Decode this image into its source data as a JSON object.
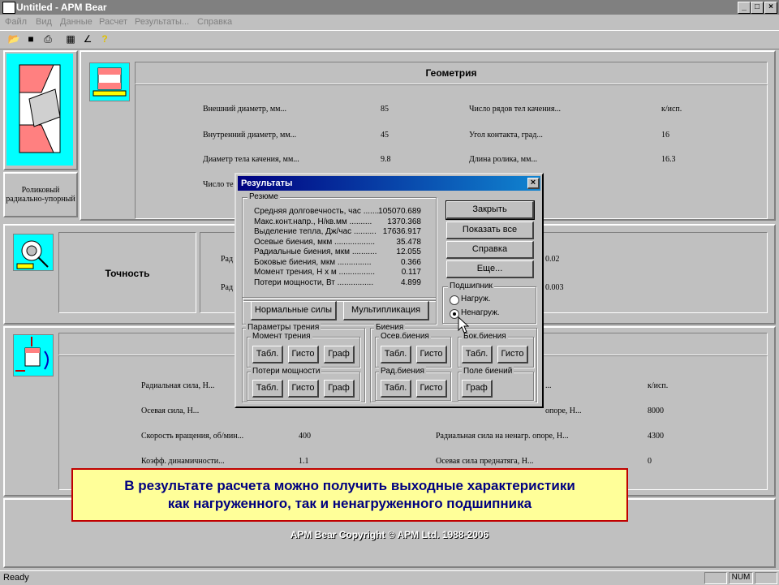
{
  "window": {
    "title": "Untitled - APM Bear"
  },
  "menu": [
    "Файл",
    "Вид",
    "Данные",
    "Расчет",
    "Результаты...",
    "Справка"
  ],
  "toolbar_icons": [
    "open-icon",
    "save-icon",
    "print-icon",
    "table-icon",
    "chart-icon",
    "help-icon"
  ],
  "left_panel": {
    "bearing_label_1": "Роликовый",
    "bearing_label_2": "радиально-упорный"
  },
  "geometry": {
    "title": "Геометрия",
    "rows": [
      {
        "label": "Внешний диаметр, мм...",
        "value": "85",
        "label2": "Число рядов тел качения...",
        "value2": "к/исп."
      },
      {
        "label": "Внутренний диаметр, мм...",
        "value": "45",
        "label2": "Угол контакта, град...",
        "value2": "16"
      },
      {
        "label": "Диаметр тела качения, мм...",
        "value": "9.8",
        "label2": "Длина ролика, мм...",
        "value2": "16.3"
      },
      {
        "label": "Число те",
        "value": "",
        "label2": "",
        "value2": ""
      }
    ]
  },
  "precision": {
    "title": "Точность",
    "row1_label": "Рад",
    "row1_value": "0.02",
    "row2_label": "Рад",
    "row2_value": "0.003"
  },
  "loads": {
    "rows": [
      {
        "label": "Радиальная сила, Н...",
        "value": "",
        "label2": "...",
        "value2": "к/исп."
      },
      {
        "label": "Осевая сила, Н...",
        "value": "",
        "label2": "опоре, Н...",
        "value2": "8000"
      },
      {
        "label": "Скорость вращения, об/мин...",
        "value": "400",
        "label2": "Радиальная сила на ненагр. опоре, Н...",
        "value2": "4300"
      },
      {
        "label": "Коэфф. динамичности...",
        "value": "1.1",
        "label2": "Осевая сила преднатяга, Н...",
        "value2": "0"
      }
    ]
  },
  "dialog": {
    "title": "Результаты",
    "summary_label": "Резюме",
    "summary": [
      {
        "label": "Средняя долговечность, час .......",
        "value": "105070.689"
      },
      {
        "label": "Макс.конт.напр., Н/кв.мм ..........",
        "value": "1370.368"
      },
      {
        "label": "Выделение тепла, Дж/час ..........",
        "value": "17636.917"
      },
      {
        "label": "Осевые биения, мкм ..................",
        "value": "35.478"
      },
      {
        "label": "Радиальные биения, мкм ...........",
        "value": "12.055"
      },
      {
        "label": "Боковые биения, мкм ...............",
        "value": "0.366"
      },
      {
        "label": "Момент трения, Н х м ................",
        "value": "0.117"
      },
      {
        "label": "Потери мощности, Вт ................",
        "value": "4.899"
      }
    ],
    "buttons": {
      "close": "Закрыть",
      "show_all": "Показать все",
      "help": "Справка",
      "more": "Еще..."
    },
    "bearing_group": "Подшипник",
    "radio_loaded": "Нагруж.",
    "radio_unloaded": "Ненагруж.",
    "selected": "Ненагруж.",
    "normal_forces": "Нормальные силы",
    "multiplication": "Мультипликация",
    "friction_group": "Параметры трения",
    "moment_group": "Момент трения",
    "power_group": "Потери мощности",
    "runout_group": "Биения",
    "axial_runout": "Осев.биения",
    "radial_runout": "Рад.биения",
    "side_runout": "Бок.биения",
    "field_runout": "Поле биений",
    "tabl": "Табл.",
    "gisto": "Гисто",
    "graf": "Граф"
  },
  "caption": {
    "line1": "В результате расчета можно получить выходные характеристики",
    "line2": "как нагруженного, так и ненагруженного подшипника"
  },
  "copyright": "APM Bear Copyright © APM Ltd. 1988-2006",
  "status": {
    "text": "Ready",
    "num": "NUM"
  }
}
